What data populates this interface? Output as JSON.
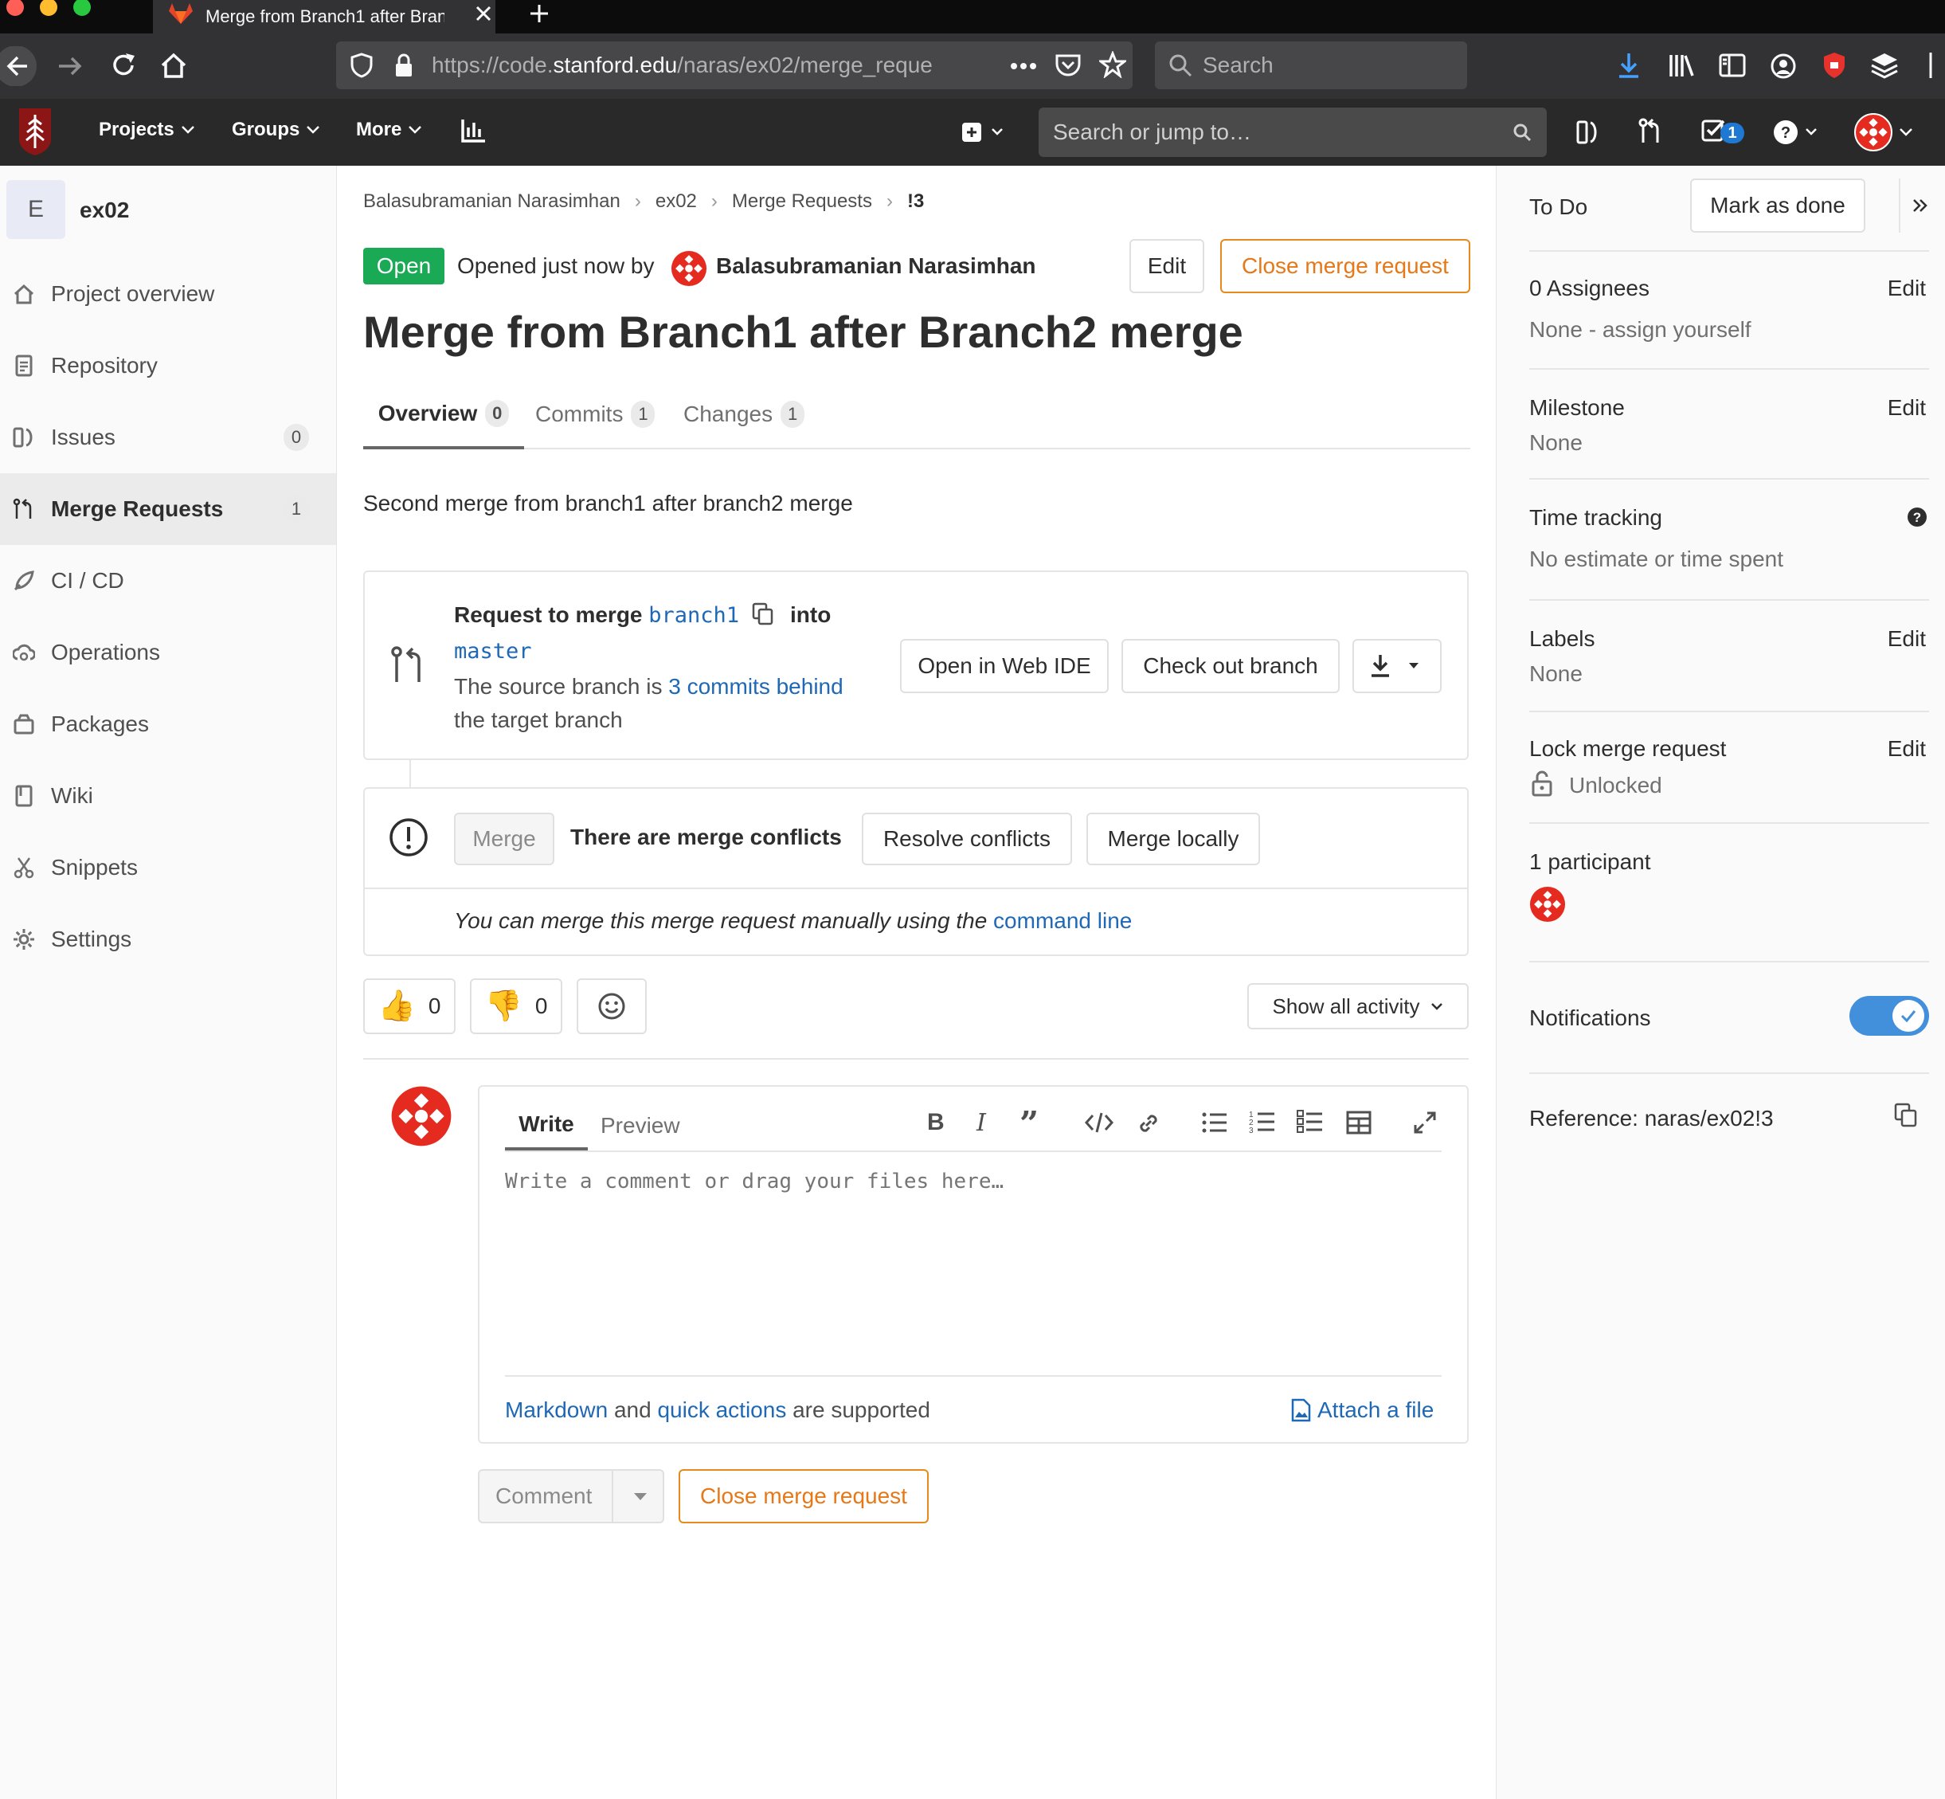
{
  "browser": {
    "tab_title": "Merge from Branch1 after Branch2 merge",
    "url_prefix": "https://code.",
    "url_domain": "stanford.edu",
    "url_path": "/naras/ex02/merge_reque",
    "search_placeholder": "Search"
  },
  "navbar": {
    "projects": "Projects",
    "groups": "Groups",
    "more": "More",
    "search_placeholder": "Search or jump to…",
    "todo_count": "1"
  },
  "sidebar": {
    "project_letter": "E",
    "project_name": "ex02",
    "items": [
      {
        "label": "Project overview",
        "icon": "home-icon"
      },
      {
        "label": "Repository",
        "icon": "doc-icon"
      },
      {
        "label": "Issues",
        "icon": "issues-icon",
        "badge": "0"
      },
      {
        "label": "Merge Requests",
        "icon": "merge-request-icon",
        "badge": "1"
      },
      {
        "label": "CI / CD",
        "icon": "rocket-icon"
      },
      {
        "label": "Operations",
        "icon": "cloud-gear-icon"
      },
      {
        "label": "Packages",
        "icon": "package-icon"
      },
      {
        "label": "Wiki",
        "icon": "book-icon"
      },
      {
        "label": "Snippets",
        "icon": "scissors-icon"
      },
      {
        "label": "Settings",
        "icon": "gear-icon"
      }
    ]
  },
  "breadcrumb": [
    "Balasubramanian Narasimhan",
    "ex02",
    "Merge Requests",
    "!3"
  ],
  "mr": {
    "status": "Open",
    "opened_text": "Opened just now by",
    "author": "Balasubramanian Narasimhan",
    "edit": "Edit",
    "close": "Close merge request",
    "title": "Merge from Branch1 after Branch2 merge",
    "tabs": [
      {
        "label": "Overview",
        "count": "0"
      },
      {
        "label": "Commits",
        "count": "1"
      },
      {
        "label": "Changes",
        "count": "1"
      }
    ],
    "description": "Second merge from branch1 after branch2 merge"
  },
  "widget": {
    "request_to_merge": "Request to merge",
    "source_branch": "branch1",
    "into": "into",
    "target_branch": "master",
    "behind_prefix": "The source branch is",
    "behind_link": "3 commits behind",
    "behind_suffix": "the target branch",
    "open_web_ide": "Open in Web IDE",
    "check_out_branch": "Check out branch",
    "merge_button": "Merge",
    "conflicts_text": "There are merge conflicts",
    "resolve_conflicts": "Resolve conflicts",
    "merge_locally": "Merge locally",
    "manual_text": "You can merge this merge request manually using the",
    "command_line": "command line"
  },
  "awards": {
    "thumbs_up": "0",
    "thumbs_down": "0",
    "show_activity": "Show all activity"
  },
  "comment": {
    "write_tab": "Write",
    "preview_tab": "Preview",
    "placeholder": "Write a comment or drag your files here…",
    "markdown": "Markdown",
    "and": "and",
    "quick_actions": "quick actions",
    "supported": "are supported",
    "attach": "Attach a file",
    "comment_button": "Comment",
    "close_button": "Close merge request"
  },
  "right_sidebar": {
    "todo": "To Do",
    "mark_done": "Mark as done",
    "assignees": "0 Assignees",
    "assignees_edit": "Edit",
    "assignees_none": "None -",
    "assign_yourself": "assign yourself",
    "milestone": "Milestone",
    "milestone_edit": "Edit",
    "milestone_value": "None",
    "time_tracking": "Time tracking",
    "time_value": "No estimate or time spent",
    "labels": "Labels",
    "labels_edit": "Edit",
    "labels_value": "None",
    "lock": "Lock merge request",
    "lock_edit": "Edit",
    "lock_value": "Unlocked",
    "participants": "1 participant",
    "notifications": "Notifications",
    "notifications_on": true,
    "reference": "Reference: naras/ex02!3"
  },
  "colors": {
    "open_badge": "#1aaa55",
    "link": "#1f68b6",
    "close_orange": "#e67817",
    "toggle_blue": "#428fdc",
    "stanford_red": "#8c1515"
  }
}
